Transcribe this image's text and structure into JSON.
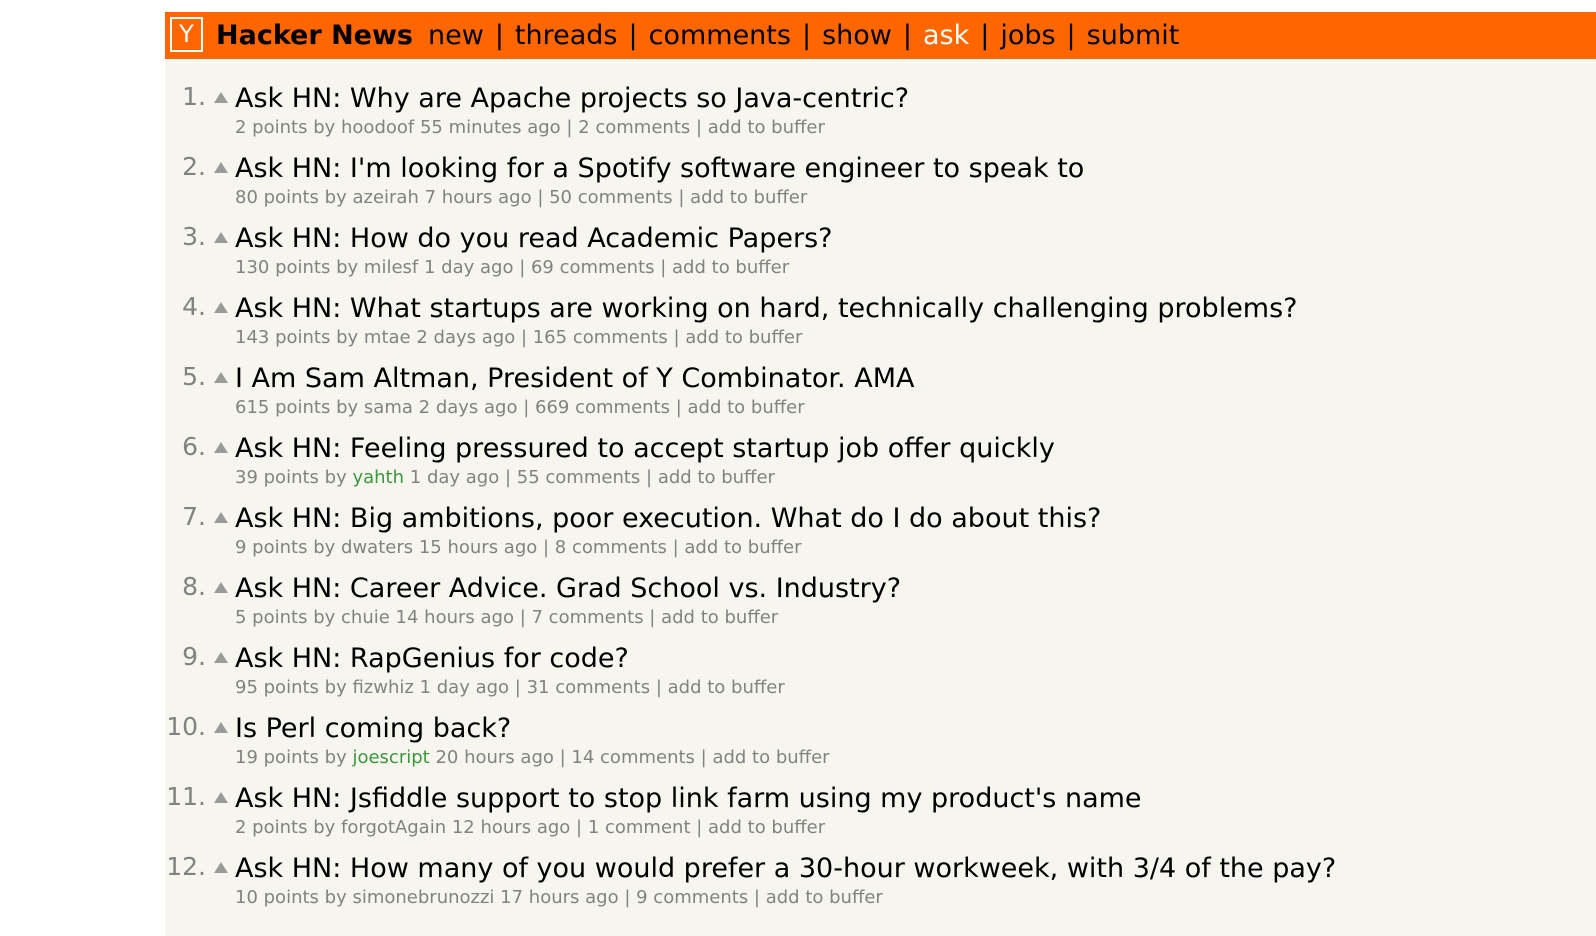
{
  "header": {
    "logo": "Y",
    "site_name": "Hacker News",
    "nav": [
      {
        "label": "new",
        "active": false
      },
      {
        "label": "threads",
        "active": false
      },
      {
        "label": "comments",
        "active": false
      },
      {
        "label": "show",
        "active": false
      },
      {
        "label": "ask",
        "active": true
      },
      {
        "label": "jobs",
        "active": false
      },
      {
        "label": "submit",
        "active": false
      }
    ],
    "separator": "|"
  },
  "items": [
    {
      "rank": "1.",
      "title": "Ask HN: Why are Apache projects so Java-centric?",
      "points": "2 points",
      "by": "by",
      "user": "hoodoof",
      "user_new": false,
      "age": "55 minutes ago",
      "comments": "2 comments",
      "buffer": "add to buffer"
    },
    {
      "rank": "2.",
      "title": "Ask HN: I'm looking for a Spotify software engineer to speak to",
      "points": "80 points",
      "by": "by",
      "user": "azeirah",
      "user_new": false,
      "age": "7 hours ago",
      "comments": "50 comments",
      "buffer": "add to buffer"
    },
    {
      "rank": "3.",
      "title": "Ask HN: How do you read Academic Papers?",
      "points": "130 points",
      "by": "by",
      "user": "milesf",
      "user_new": false,
      "age": "1 day ago",
      "comments": "69 comments",
      "buffer": "add to buffer"
    },
    {
      "rank": "4.",
      "title": "Ask HN: What startups are working on hard, technically challenging problems?",
      "points": "143 points",
      "by": "by",
      "user": "mtae",
      "user_new": false,
      "age": "2 days ago",
      "comments": "165 comments",
      "buffer": "add to buffer"
    },
    {
      "rank": "5.",
      "title": "I Am Sam Altman, President of Y Combinator. AMA",
      "points": "615 points",
      "by": "by",
      "user": "sama",
      "user_new": false,
      "age": "2 days ago",
      "comments": "669 comments",
      "buffer": "add to buffer"
    },
    {
      "rank": "6.",
      "title": "Ask HN: Feeling pressured to accept startup job offer quickly",
      "points": "39 points",
      "by": "by",
      "user": "yahth",
      "user_new": true,
      "age": "1 day ago",
      "comments": "55 comments",
      "buffer": "add to buffer"
    },
    {
      "rank": "7.",
      "title": "Ask HN: Big ambitions, poor execution. What do I do about this?",
      "points": "9 points",
      "by": "by",
      "user": "dwaters",
      "user_new": false,
      "age": "15 hours ago",
      "comments": "8 comments",
      "buffer": "add to buffer"
    },
    {
      "rank": "8.",
      "title": "Ask HN: Career Advice. Grad School vs. Industry?",
      "points": "5 points",
      "by": "by",
      "user": "chuie",
      "user_new": false,
      "age": "14 hours ago",
      "comments": "7 comments",
      "buffer": "add to buffer"
    },
    {
      "rank": "9.",
      "title": "Ask HN: RapGenius for code?",
      "points": "95 points",
      "by": "by",
      "user": "fizwhiz",
      "user_new": false,
      "age": "1 day ago",
      "comments": "31 comments",
      "buffer": "add to buffer"
    },
    {
      "rank": "10.",
      "title": "Is Perl coming back?",
      "points": "19 points",
      "by": "by",
      "user": "joescript",
      "user_new": true,
      "age": "20 hours ago",
      "comments": "14 comments",
      "buffer": "add to buffer"
    },
    {
      "rank": "11.",
      "title": "Ask HN: Jsfiddle support to stop link farm using my product's name",
      "points": "2 points",
      "by": "by",
      "user": "forgotAgain",
      "user_new": false,
      "age": "12 hours ago",
      "comments": "1 comment",
      "buffer": "add to buffer"
    },
    {
      "rank": "12.",
      "title": "Ask HN: How many of you would prefer a 30-hour workweek, with 3/4 of the pay?",
      "points": "10 points",
      "by": "by",
      "user": "simonebrunozzi",
      "user_new": false,
      "age": "17 hours ago",
      "comments": "9 comments",
      "buffer": "add to buffer"
    }
  ],
  "colors": {
    "header_bg": "#ff6600",
    "page_bg": "#f6f6ef",
    "subtext": "#828282",
    "new_user": "#3c963c",
    "active_nav": "#ffffff"
  },
  "icons": {
    "logo": "y-logo-icon",
    "vote": "upvote-arrow-icon"
  }
}
